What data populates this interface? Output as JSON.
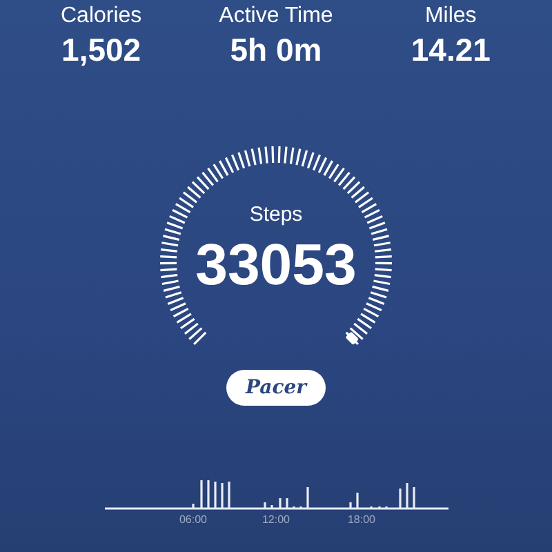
{
  "stats": [
    {
      "label": "Calories",
      "value": "1,502"
    },
    {
      "label": "Active Time",
      "value": "5h 0m"
    },
    {
      "label": "Miles",
      "value": "14.21"
    }
  ],
  "gauge": {
    "label": "Steps",
    "value": "33053"
  },
  "brand_button": {
    "label": "Pacer"
  },
  "activity_chart": {
    "x_labels": [
      "06:00",
      "12:00",
      "18:00"
    ]
  }
}
